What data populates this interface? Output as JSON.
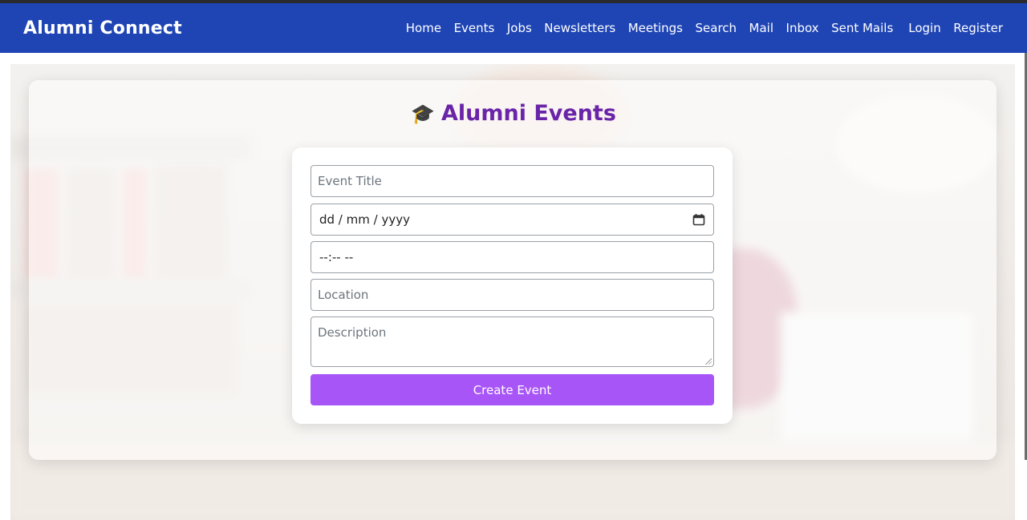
{
  "navbar": {
    "brand": "Alumni Connect",
    "links": [
      "Home",
      "Events",
      "Jobs",
      "Newsletters",
      "Meetings",
      "Search",
      "Mail",
      "Inbox",
      "Sent Mails",
      "Login",
      "Register"
    ]
  },
  "page": {
    "title": "Alumni Events",
    "title_icon": "🎓"
  },
  "form": {
    "title_placeholder": "Event Title",
    "date_placeholder": "dd / mm / yyyy",
    "time_placeholder": "--:-- --",
    "location_placeholder": "Location",
    "description_placeholder": "Description",
    "submit_label": "Create Event"
  },
  "colors": {
    "navbar": "#1f45b5",
    "title": "#6a24a8",
    "button": "#a855f7"
  }
}
